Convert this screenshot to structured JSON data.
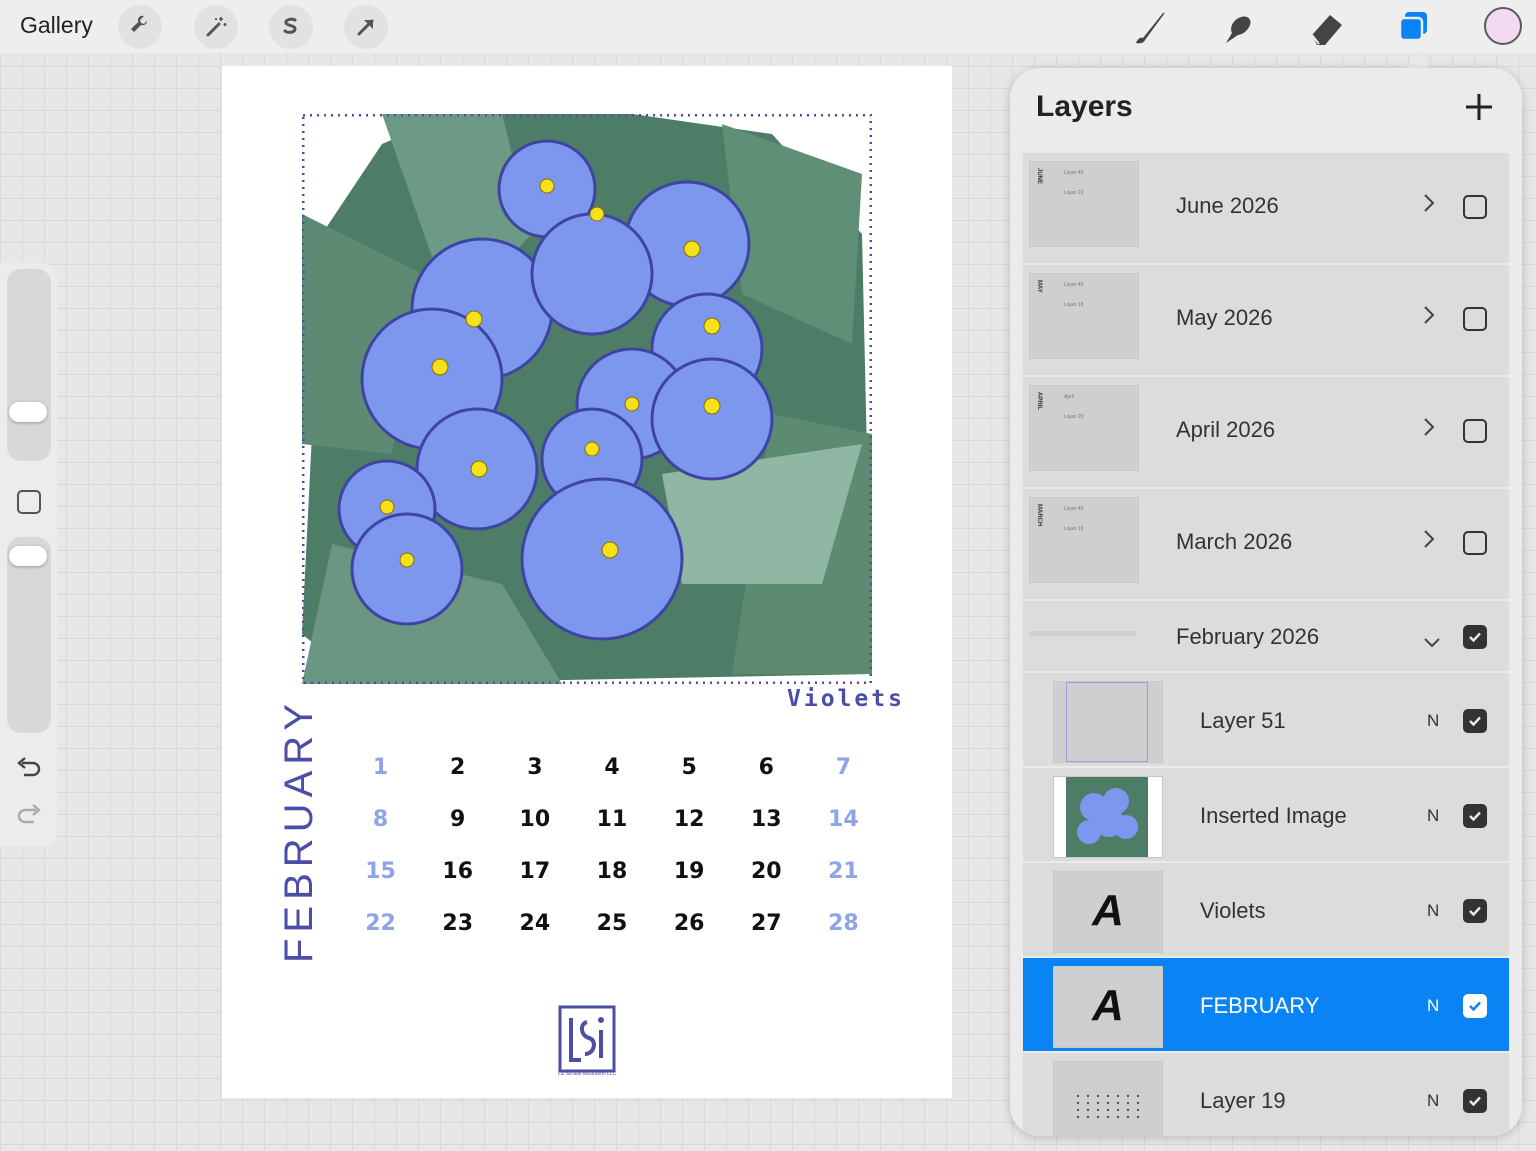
{
  "topbar": {
    "gallery_label": "Gallery",
    "left_tools": [
      "wrench-icon",
      "magic-wand-icon",
      "selection-icon",
      "transform-arrow-icon"
    ],
    "right_tools": [
      "brush-icon",
      "smudge-icon",
      "eraser-icon",
      "layers-icon"
    ],
    "active_tool": "layers-icon",
    "current_color": "#f3d9f1"
  },
  "canvas": {
    "art_caption": "Violets",
    "month": "FEBRUARY",
    "weeks": [
      [
        "1",
        "2",
        "3",
        "4",
        "5",
        "6",
        "7"
      ],
      [
        "8",
        "9",
        "10",
        "11",
        "12",
        "13",
        "14"
      ],
      [
        "15",
        "16",
        "17",
        "18",
        "19",
        "20",
        "21"
      ],
      [
        "22",
        "23",
        "24",
        "25",
        "26",
        "27",
        "28"
      ]
    ],
    "logo_text": "LSi",
    "logo_caption": "Liz Stroble Illustration LLC",
    "colors": {
      "accent": "#4a4ea6",
      "weekend": "#8ea4e6",
      "flower": "#7d97ef"
    }
  },
  "layers": {
    "title": "Layers",
    "groups": [
      {
        "name": "June 2026",
        "visible": false,
        "thumb_text": "JUNE",
        "mini": [
          "Layer 46",
          "Layer 22"
        ]
      },
      {
        "name": "May 2026",
        "visible": false,
        "thumb_text": "MAY",
        "mini": [
          "Layer 46",
          "Layer 18"
        ]
      },
      {
        "name": "April 2026",
        "visible": false,
        "thumb_text": "APRIL",
        "mini": [
          "April",
          "Layer 20"
        ]
      },
      {
        "name": "March 2026",
        "visible": false,
        "thumb_text": "MARCH",
        "mini": [
          "Layer 46",
          "Layer 19"
        ]
      }
    ],
    "expanded_group": {
      "name": "February 2026",
      "visible": true
    },
    "items": [
      {
        "name": "Layer 51",
        "blend": "N",
        "visible": true,
        "selected": false
      },
      {
        "name": "Inserted Image",
        "blend": "N",
        "visible": true,
        "selected": false
      },
      {
        "name": "Violets",
        "blend": "N",
        "visible": true,
        "selected": false
      },
      {
        "name": "FEBRUARY",
        "blend": "N",
        "visible": true,
        "selected": true
      },
      {
        "name": "Layer 19",
        "blend": "N",
        "visible": true,
        "selected": false
      }
    ],
    "text_layer_glyph": "A"
  }
}
